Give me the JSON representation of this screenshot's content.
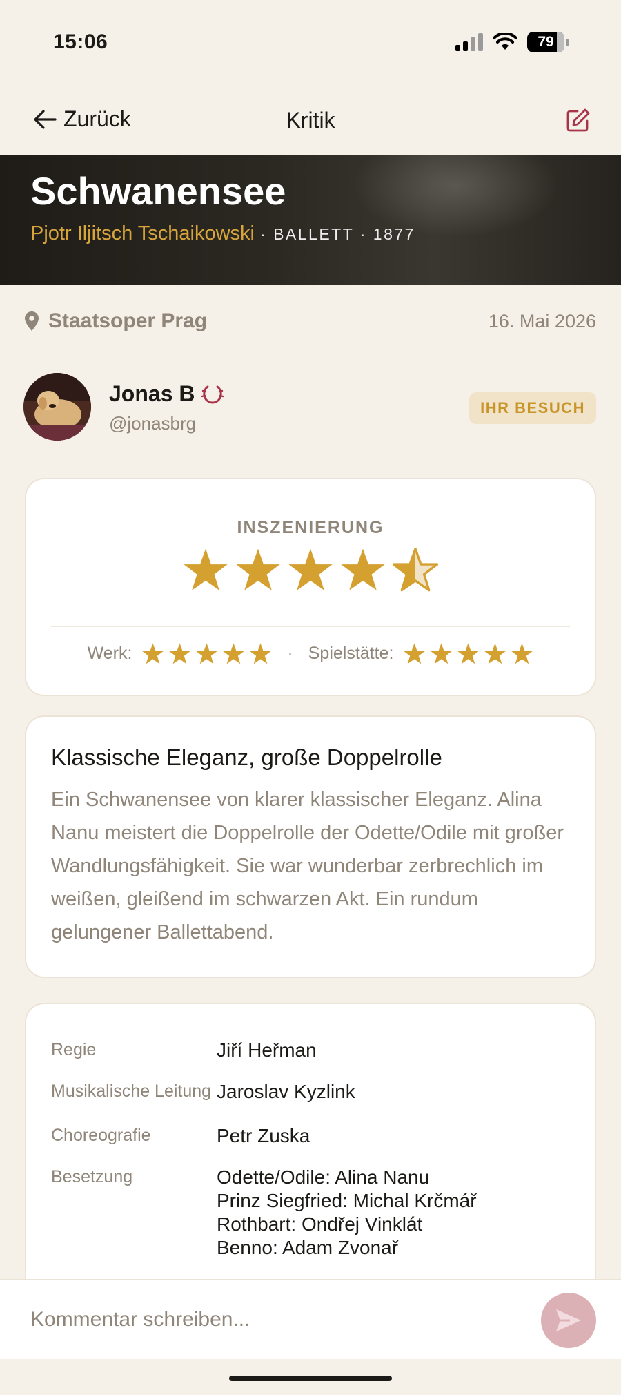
{
  "status": {
    "time": "15:06",
    "battery": "79"
  },
  "nav": {
    "back_label": "Zurück",
    "title": "Kritik"
  },
  "hero": {
    "title": "Schwanensee",
    "composer": "Pjotr Iljitsch Tschaikowski",
    "meta": "· BALLETT · 1877"
  },
  "venue": {
    "name": "Staatsoper Prag",
    "date": "16. Mai 2026"
  },
  "author": {
    "name": "Jonas B",
    "handle": "@jonasbrg",
    "badge": "IHR BESUCH"
  },
  "rating": {
    "label": "INSZENIERUNG",
    "value": 4.5,
    "max": 5,
    "werk_label": "Werk:",
    "werk_value": 5,
    "spielstaette_label": "Spielstätte:",
    "spielstaette_value": 5,
    "star_color": "#d4a030"
  },
  "review": {
    "title": "Klassische Eleganz, große Doppelrolle",
    "body": "Ein Schwanensee von klarer klassischer Eleganz. Alina Nanu meistert die Doppelrolle der Odette/Odile mit großer Wandlungsfähigkeit. Sie war wunderbar zerbrechlich im weißen, gleißend im schwarzen Akt. Ein rundum gelungener Ballettabend."
  },
  "credits": [
    {
      "label": "Regie",
      "values": [
        "Jiří Heřman"
      ]
    },
    {
      "label": "Musikalische Leitung",
      "values": [
        "Jaroslav Kyzlink"
      ]
    },
    {
      "label": "Choreografie",
      "values": [
        "Petr Zuska"
      ]
    },
    {
      "label": "Besetzung",
      "values": [
        "Odette/Odile: Alina Nanu",
        "Prinz Siegfried: Michal Krčmář",
        "Rothbart: Ondřej Vinklát",
        "Benno: Adam Zvonař"
      ]
    }
  ],
  "comment": {
    "placeholder": "Kommentar schreiben..."
  },
  "colors": {
    "accent_gold": "#d4a030",
    "accent_red": "#a8344a",
    "background": "#f6f1e8"
  }
}
